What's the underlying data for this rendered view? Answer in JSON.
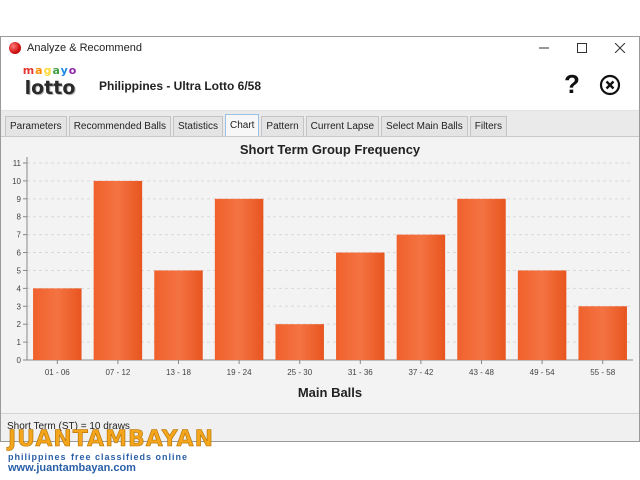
{
  "window": {
    "title": "Analyze & Recommend",
    "controls": {
      "minimize": "—",
      "maximize": "☐",
      "close": "✕"
    }
  },
  "header": {
    "logo_top": "magayo",
    "logo_bottom": "lotto",
    "logo_top_colors": [
      "#e53935",
      "#fb8c00",
      "#fdd835",
      "#43a047",
      "#1e88e5",
      "#8e24aa"
    ],
    "lottery_name": "Philippines - Ultra Lotto 6/58",
    "help_label": "?"
  },
  "tabs": [
    {
      "label": "Parameters",
      "active": false
    },
    {
      "label": "Recommended Balls",
      "active": false
    },
    {
      "label": "Statistics",
      "active": false
    },
    {
      "label": "Chart",
      "active": true
    },
    {
      "label": "Pattern",
      "active": false
    },
    {
      "label": "Current Lapse",
      "active": false
    },
    {
      "label": "Select Main Balls",
      "active": false
    },
    {
      "label": "Filters",
      "active": false
    }
  ],
  "chart_data": {
    "type": "bar",
    "title": "Short Term Group Frequency",
    "xlabel": "Main Balls",
    "ylabel": "",
    "categories": [
      "01 - 06",
      "07 - 12",
      "13 - 18",
      "19 - 24",
      "25 - 30",
      "31 - 36",
      "37 - 42",
      "43 - 48",
      "49 - 54",
      "55 - 58"
    ],
    "values": [
      4,
      10,
      5,
      9,
      2,
      6,
      7,
      9,
      5,
      3
    ],
    "ylim": [
      0,
      11
    ],
    "yticks": [
      0,
      1,
      2,
      3,
      4,
      5,
      6,
      7,
      8,
      9,
      10,
      11
    ],
    "bar_color": "#f0612c",
    "grid": true,
    "legend": "none"
  },
  "status": {
    "text": "Short Term (ST) = 10 draws"
  },
  "watermark": {
    "brand": "JUANTAMBAYAN",
    "sub_left": "philippines",
    "sub_right": "free classifieds online",
    "url": "www.juantambayan.com"
  }
}
